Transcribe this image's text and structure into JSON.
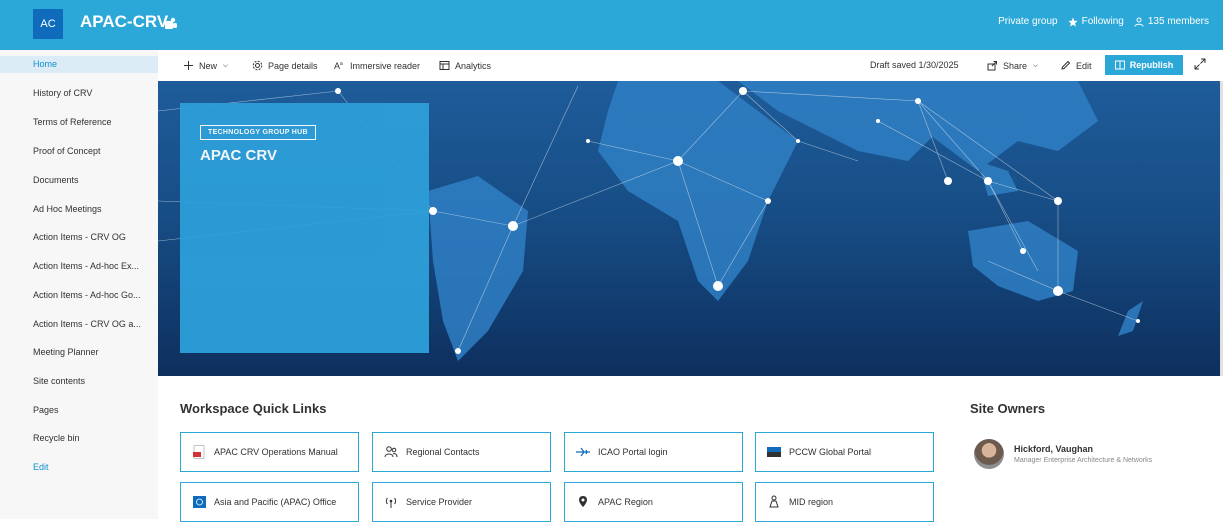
{
  "header": {
    "site_initials": "AC",
    "site_title": "APAC-CRV",
    "group_type": "Private group",
    "following": "Following",
    "members": "135 members"
  },
  "nav": {
    "items": [
      {
        "label": "Home"
      },
      {
        "label": "History of CRV"
      },
      {
        "label": "Terms of Reference"
      },
      {
        "label": "Proof of Concept"
      },
      {
        "label": "Documents"
      },
      {
        "label": "Ad Hoc Meetings"
      },
      {
        "label": "Action Items - CRV OG"
      },
      {
        "label": "Action Items - Ad-hoc Ex..."
      },
      {
        "label": "Action Items - Ad-hoc Go..."
      },
      {
        "label": "Action Items - CRV OG a..."
      },
      {
        "label": "Meeting Planner"
      },
      {
        "label": "Site contents"
      },
      {
        "label": "Pages"
      },
      {
        "label": "Recycle bin"
      }
    ],
    "edit": "Edit"
  },
  "commandbar": {
    "new": "New",
    "page_details": "Page details",
    "immersive_reader": "Immersive reader",
    "analytics": "Analytics",
    "draft_saved": "Draft saved 1/30/2025",
    "share": "Share",
    "edit": "Edit",
    "republish": "Republish"
  },
  "hero": {
    "tag": "TECHNOLOGY GROUP HUB",
    "title": "APAC CRV"
  },
  "quick_links": {
    "title": "Workspace Quick Links",
    "items": [
      {
        "label": "APAC CRV Operations Manual",
        "icon": "pdf-icon"
      },
      {
        "label": "Regional Contacts",
        "icon": "people-icon"
      },
      {
        "label": "ICAO Portal login",
        "icon": "airplane-icon"
      },
      {
        "label": "PCCW Global Portal",
        "icon": "pccw-logo-icon"
      },
      {
        "label": "Asia and Pacific (APAC) Office",
        "icon": "icao-logo-icon"
      },
      {
        "label": "Service Provider",
        "icon": "antenna-icon"
      },
      {
        "label": "APAC Region",
        "icon": "location-icon"
      },
      {
        "label": "MID region",
        "icon": "person-location-icon"
      }
    ]
  },
  "owners": {
    "title": "Site Owners",
    "name": "Hickford, Vaughan",
    "role": "Manager Enterprise Architecture & Networks"
  },
  "colors": {
    "suite_bar": "#2ba8d8",
    "accent": "#0f8fd1",
    "hero_dark": "#0d2f5e",
    "hero_panel": "#2d9fd9"
  }
}
